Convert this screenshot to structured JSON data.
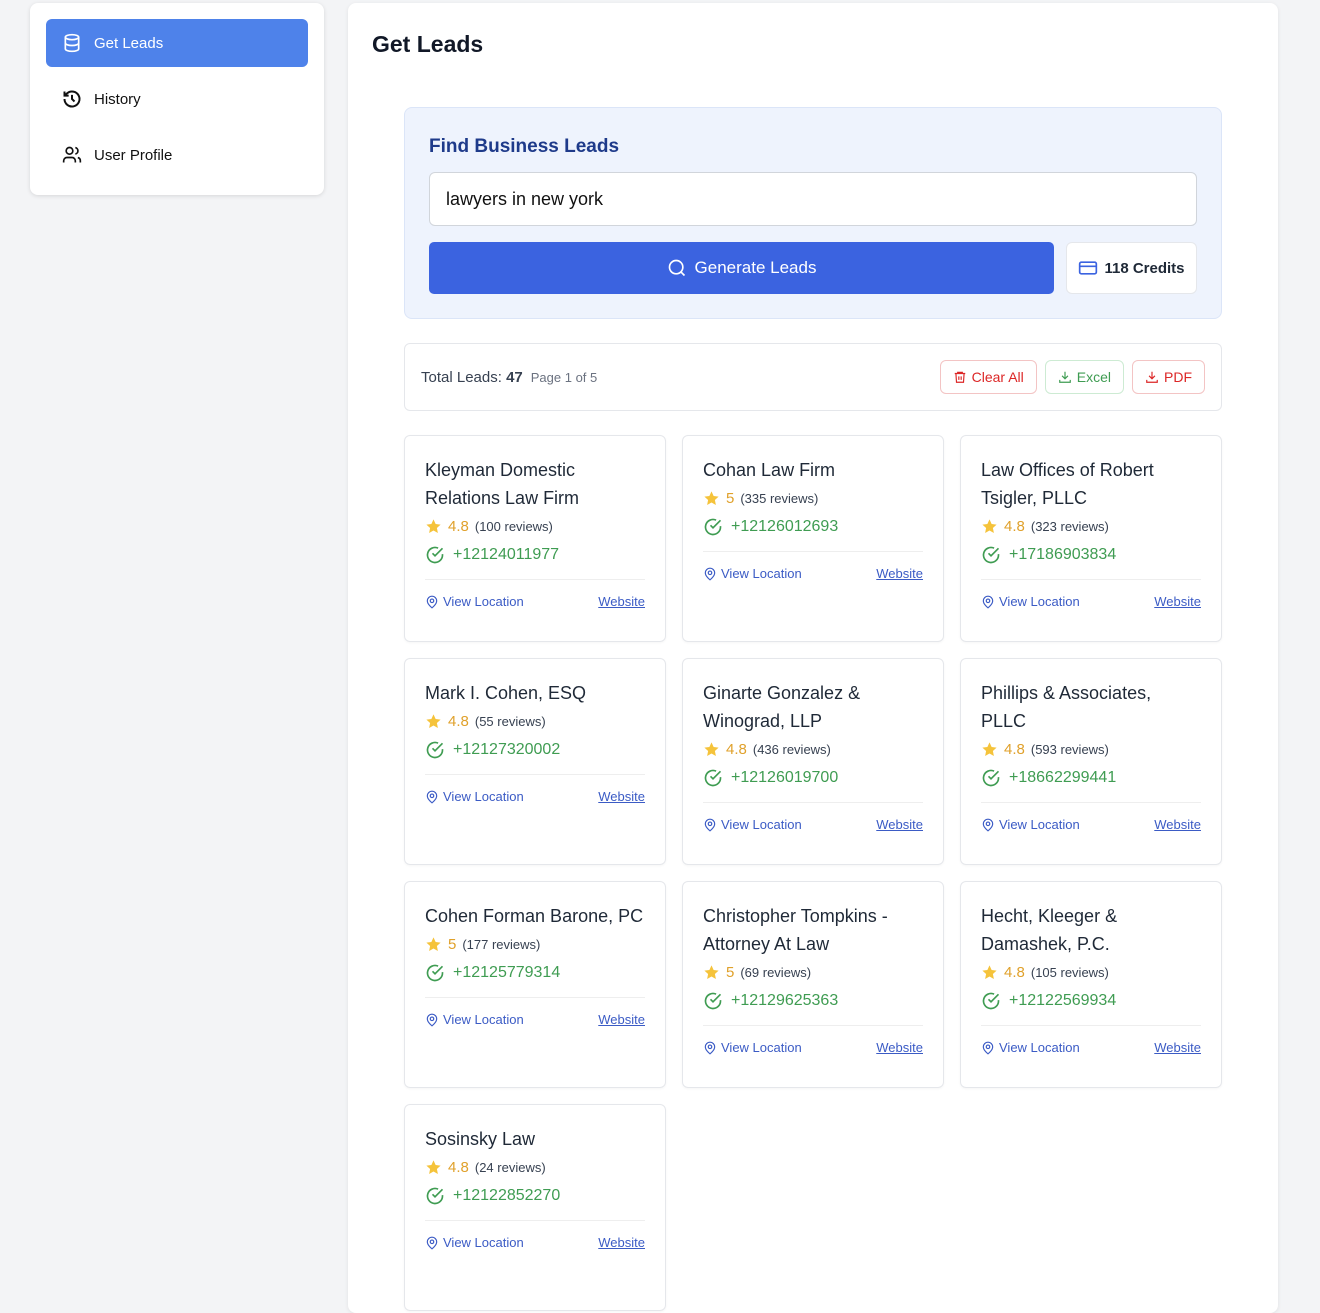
{
  "sidebar": {
    "items": [
      {
        "label": "Get Leads",
        "icon": "database-icon"
      },
      {
        "label": "History",
        "icon": "history-icon"
      },
      {
        "label": "User Profile",
        "icon": "users-icon"
      }
    ]
  },
  "page_title": "Get Leads",
  "search": {
    "title": "Find Business Leads",
    "query": "lawyers in new york",
    "generate_label": "Generate Leads",
    "credits": "118 Credits"
  },
  "summary": {
    "total_label": "Total Leads:",
    "total": "47",
    "page": "Page 1 of 5",
    "clear": "Clear All",
    "excel": "Excel",
    "pdf": "PDF"
  },
  "links": {
    "location": "View Location",
    "website": "Website"
  },
  "leads": [
    {
      "name": "Kleyman Domestic Relations Law Firm",
      "rating": "4.8",
      "reviews": "(100 reviews)",
      "phone": "+12124011977"
    },
    {
      "name": "Cohan Law Firm",
      "rating": "5",
      "reviews": "(335 reviews)",
      "phone": "+12126012693"
    },
    {
      "name": "Law Offices of Robert Tsigler, PLLC",
      "rating": "4.8",
      "reviews": "(323 reviews)",
      "phone": "+17186903834"
    },
    {
      "name": "Mark I. Cohen, ESQ",
      "rating": "4.8",
      "reviews": "(55 reviews)",
      "phone": "+12127320002"
    },
    {
      "name": "Ginarte Gonzalez & Winograd, LLP",
      "rating": "4.8",
      "reviews": "(436 reviews)",
      "phone": "+12126019700"
    },
    {
      "name": "Phillips & Associates, PLLC",
      "rating": "4.8",
      "reviews": "(593 reviews)",
      "phone": "+18662299441"
    },
    {
      "name": "Cohen Forman Barone, PC",
      "rating": "5",
      "reviews": "(177 reviews)",
      "phone": "+12125779314"
    },
    {
      "name": "Christopher Tompkins - Attorney At Law",
      "rating": "5",
      "reviews": "(69 reviews)",
      "phone": "+12129625363"
    },
    {
      "name": "Hecht, Kleeger & Damashek, P.C.",
      "rating": "4.8",
      "reviews": "(105 reviews)",
      "phone": "+12122569934"
    },
    {
      "name": "Sosinsky Law",
      "rating": "4.8",
      "reviews": "(24 reviews)",
      "phone": "+12122852270"
    }
  ]
}
